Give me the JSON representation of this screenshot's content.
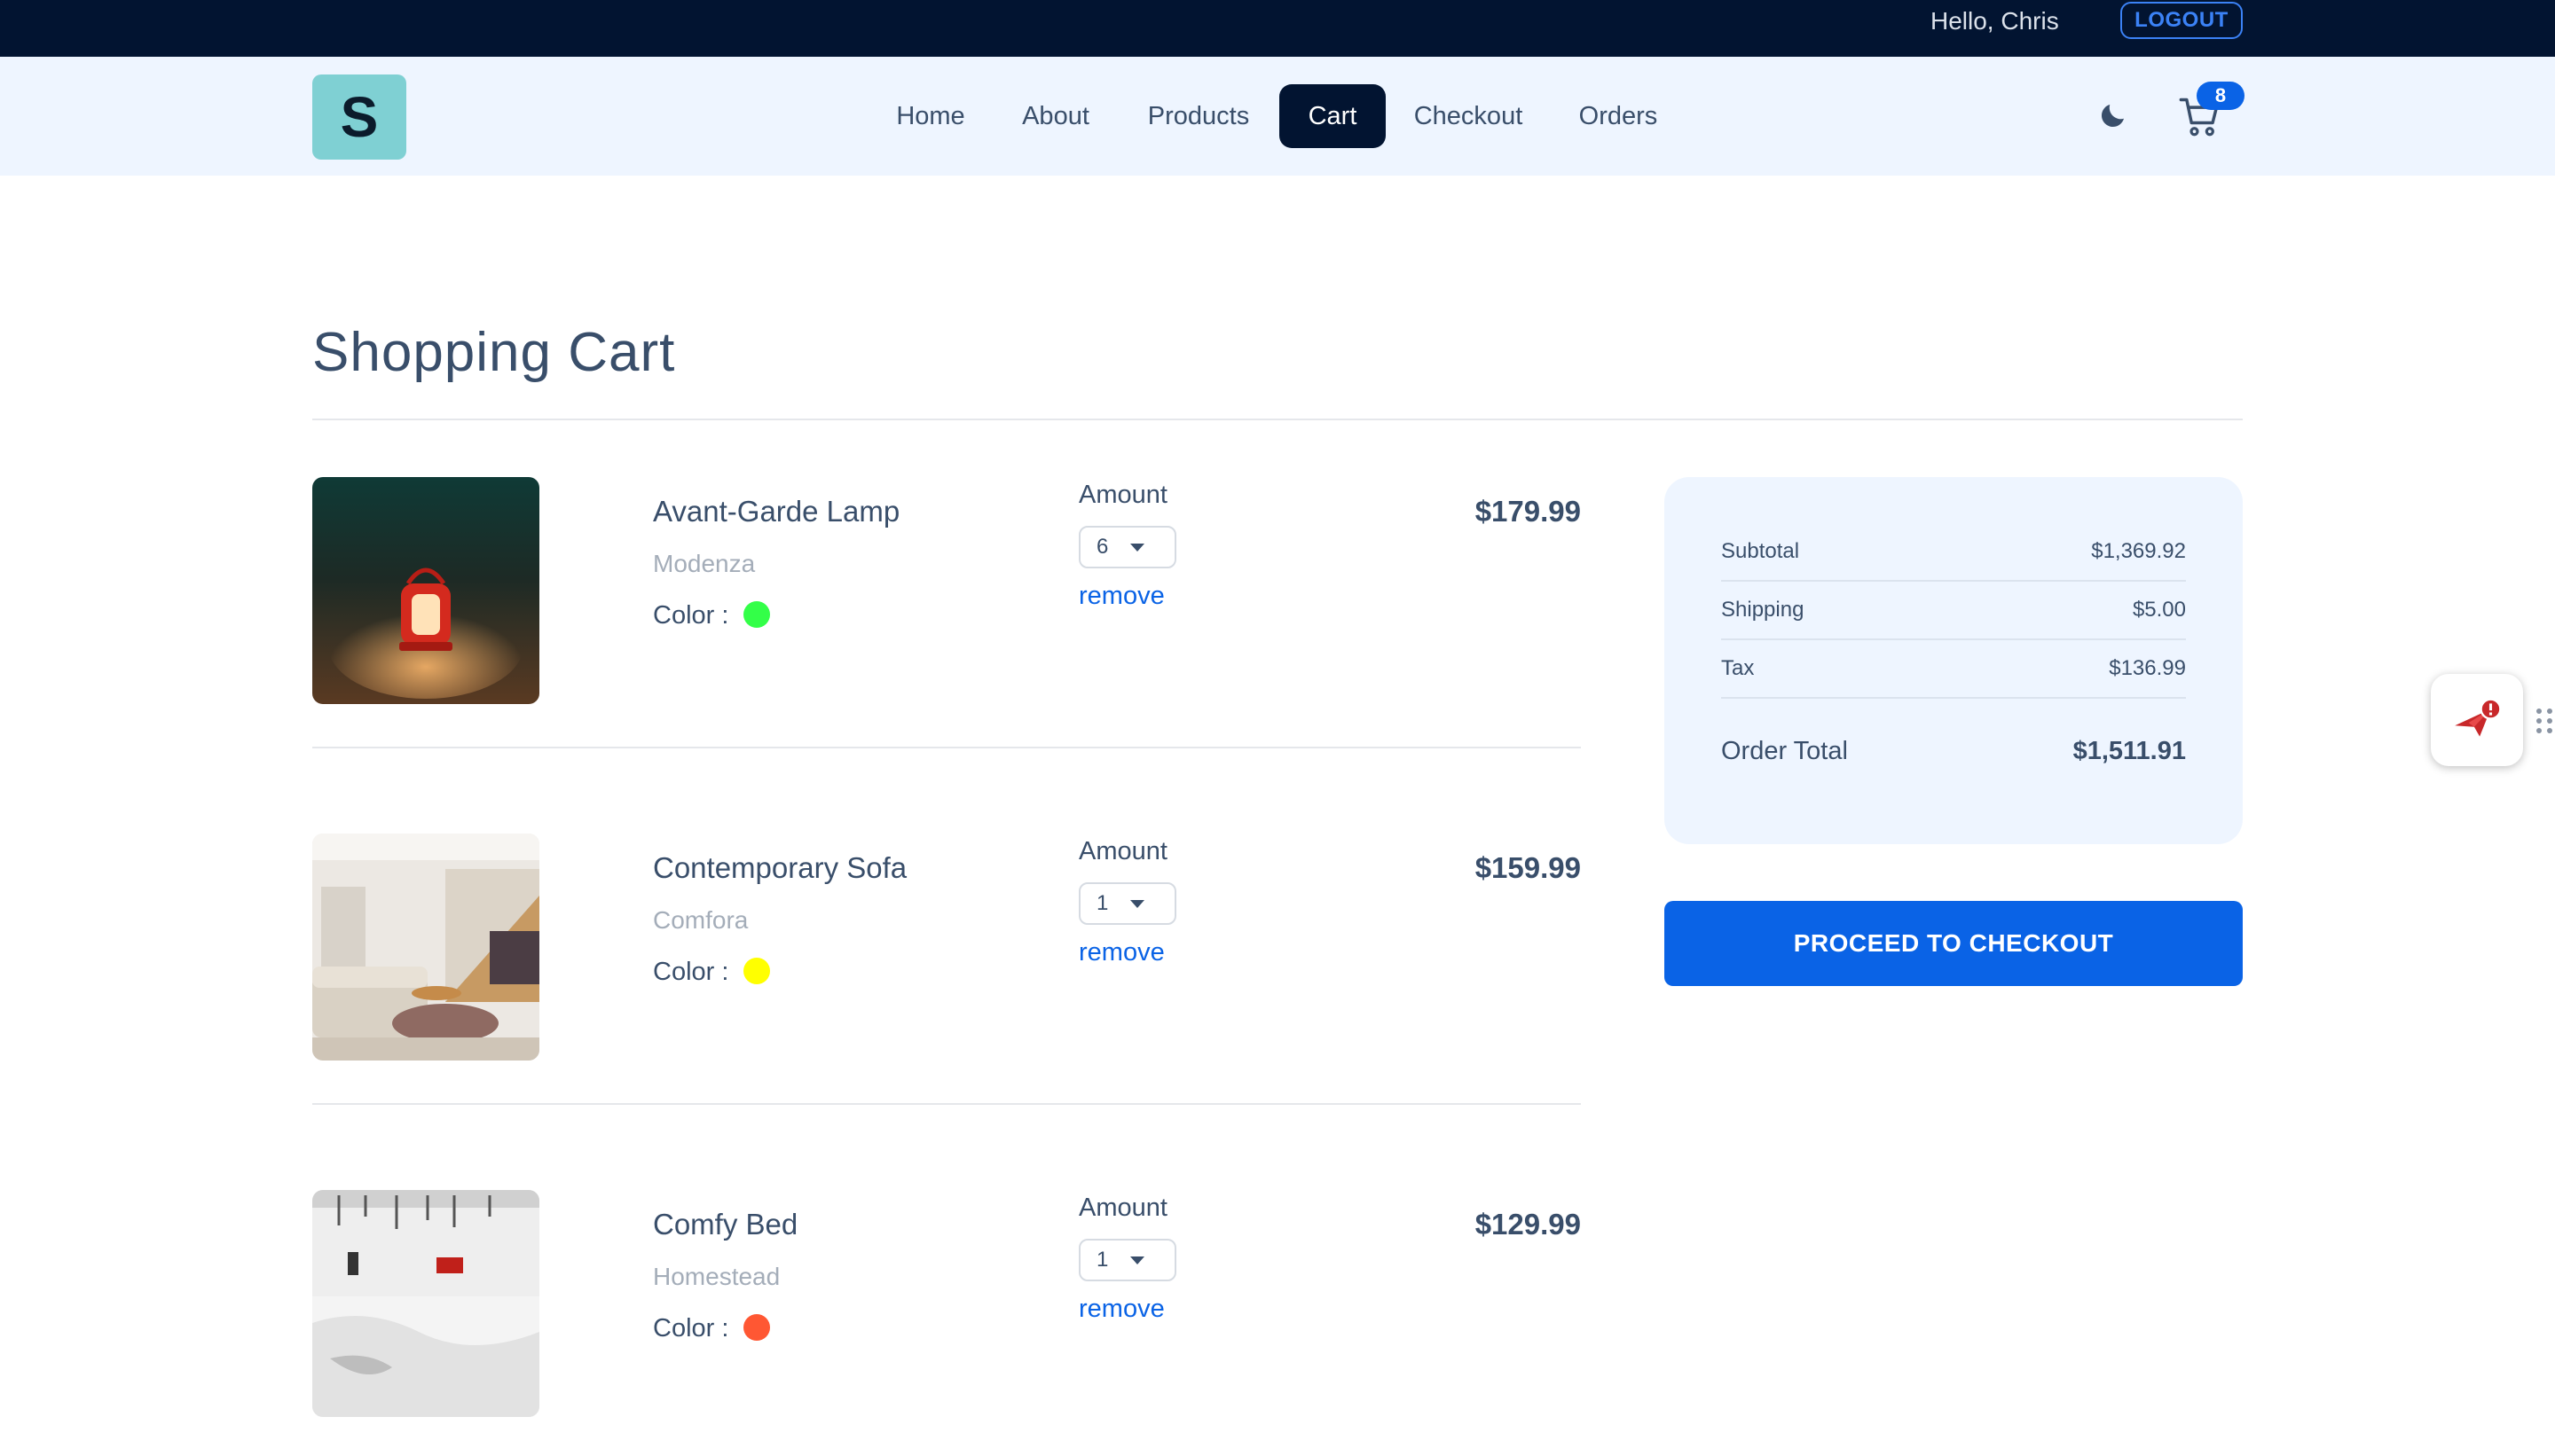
{
  "topbar": {
    "greeting": "Hello, Chris",
    "logout_label": "LOGOUT"
  },
  "brand": {
    "logo_letter": "S"
  },
  "nav": {
    "links": [
      {
        "label": "Home"
      },
      {
        "label": "About"
      },
      {
        "label": "Products"
      },
      {
        "label": "Cart",
        "active": true
      },
      {
        "label": "Checkout"
      },
      {
        "label": "Orders"
      }
    ],
    "theme_icon": "moon-icon",
    "cart_icon": "cart-icon",
    "cart_count": "8"
  },
  "page": {
    "title": "Shopping Cart"
  },
  "cart": {
    "amount_label": "Amount",
    "color_label": "Color :",
    "remove_label": "remove",
    "items": [
      {
        "name": "Avant-Garde Lamp",
        "company": "Modenza",
        "color": "#33ff48",
        "amount": "6",
        "price": "$179.99"
      },
      {
        "name": "Contemporary Sofa",
        "company": "Comfora",
        "color": "#ffff00",
        "amount": "1",
        "price": "$159.99"
      },
      {
        "name": "Comfy Bed",
        "company": "Homestead",
        "color": "#ff5733",
        "amount": "1",
        "price": "$129.99"
      }
    ]
  },
  "summary": {
    "subtotal_label": "Subtotal",
    "subtotal": "$1,369.92",
    "shipping_label": "Shipping",
    "shipping": "$5.00",
    "tax_label": "Tax",
    "tax": "$136.99",
    "total_label": "Order Total",
    "total": "$1,511.91"
  },
  "checkout_button": "PROCEED TO CHECKOUT",
  "colors": {
    "topbar": "#021431",
    "accent": "#0a63e6",
    "navbar": "#eef5ff",
    "logo": "#7fd0d3"
  }
}
